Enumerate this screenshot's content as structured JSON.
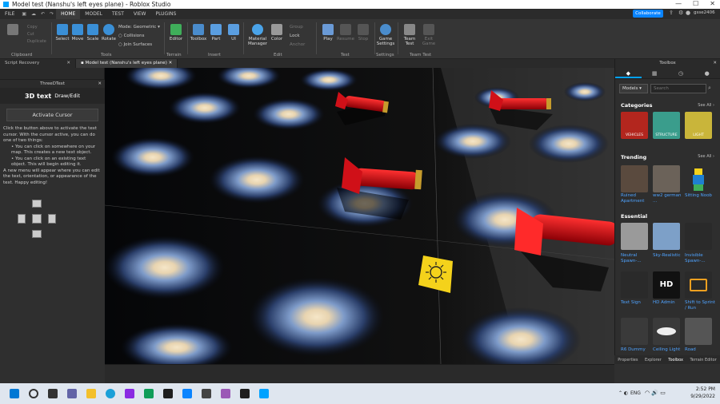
{
  "window": {
    "title": "Model test (Nanshu's left eyes plane) - Roblox Studio",
    "controls": [
      "—",
      "☐",
      "✕"
    ]
  },
  "menubar": {
    "items": [
      "FILE",
      "HOME",
      "MODEL",
      "TEST",
      "VIEW",
      "PLUGINS"
    ],
    "active": "HOME",
    "collaborate_label": "Collaborate",
    "username": "gsse2406"
  },
  "ribbon": {
    "clipboard": {
      "paste": "Paste",
      "copy": "Copy",
      "cut": "Cut",
      "duplicate": "Duplicate",
      "group_label": "Clipboard"
    },
    "tools": {
      "select": "Select",
      "move": "Move",
      "scale": "Scale",
      "rotate": "Rotate",
      "mode_label": "Mode:",
      "mode_value": "Geometric",
      "collisions": "Collisions",
      "join_surfaces": "Join Surfaces",
      "group_label": "Tools"
    },
    "terrain": {
      "editor": "Editor",
      "group_label": "Terrain"
    },
    "insert": {
      "toolbox": "Toolbox",
      "part": "Part",
      "ui": "UI",
      "group_label": "Insert"
    },
    "edit": {
      "material_manager": "Material Manager",
      "color": "Color",
      "group_label": "Edit",
      "group": "Group",
      "lock": "Lock",
      "anchor": "Anchor"
    },
    "test": {
      "play": "Play",
      "resume": "Resume",
      "stop": "Stop",
      "group_label": "Test"
    },
    "settings": {
      "game_settings": "Game Settings",
      "group_label": "Settings"
    },
    "team_test": {
      "team_test": "Team Test",
      "exit_game": "Exit Game",
      "group_label": "Team Test"
    }
  },
  "doc_tabs": [
    {
      "label": "Script Recovery",
      "closable": true
    },
    {
      "label": "Model test (Nanshu's left eyes plane)",
      "closable": true
    }
  ],
  "plugin": {
    "window_title": "ThreeDText",
    "logo_text": "3D text",
    "header_label": "Draw/Edit",
    "activate_button": "Activate Cursor",
    "intro": "Click the button above to activate the text cursor. With the cursor active, you can do one of two things:",
    "bullet1": "• You can click on somewhere on your map. This creates a new text object.",
    "bullet2": "• You can click on an existing text object. This will begin editing it.",
    "outro": "A new menu will appear where you can edit the text, orientation, or appearance of the text. Happy editing!"
  },
  "toolbox": {
    "title": "Toolbox",
    "category_select": "Models",
    "search_placeholder": "Search",
    "categories_title": "Categories",
    "see_all": "See All",
    "categories": [
      {
        "name": "VEHICLES",
        "color": "#b3261e"
      },
      {
        "name": "STRUCTURE",
        "color": "#3a9d8c"
      },
      {
        "name": "LIGHT",
        "color": "#c9b53a"
      }
    ],
    "trending_title": "Trending",
    "trending": [
      "Ruined Apartment",
      "ww2 german ...",
      "Sitting Noob"
    ],
    "essential_title": "Essential",
    "essential": [
      "Neutral Spawn-...",
      "Sky-Realistic",
      "Invisible Spawn-...",
      "Text Sign",
      "HD Admin",
      "Shift to Sprint / Run",
      "R6 Dummy",
      "Ceiling Light",
      "Road"
    ],
    "hd_text": "HD"
  },
  "bottom_tabs": [
    "Properties",
    "Explorer",
    "Toolbox",
    "Terrain Editor"
  ],
  "taskbar": {
    "time": "2:52 PM",
    "date": "9/29/2022",
    "lang": "ENG"
  },
  "colors": {
    "accent": "#00a2ff",
    "studio_bg": "#2e2e2e",
    "rocket_red": "#c8101a",
    "sign_yellow": "#f4d21b"
  }
}
